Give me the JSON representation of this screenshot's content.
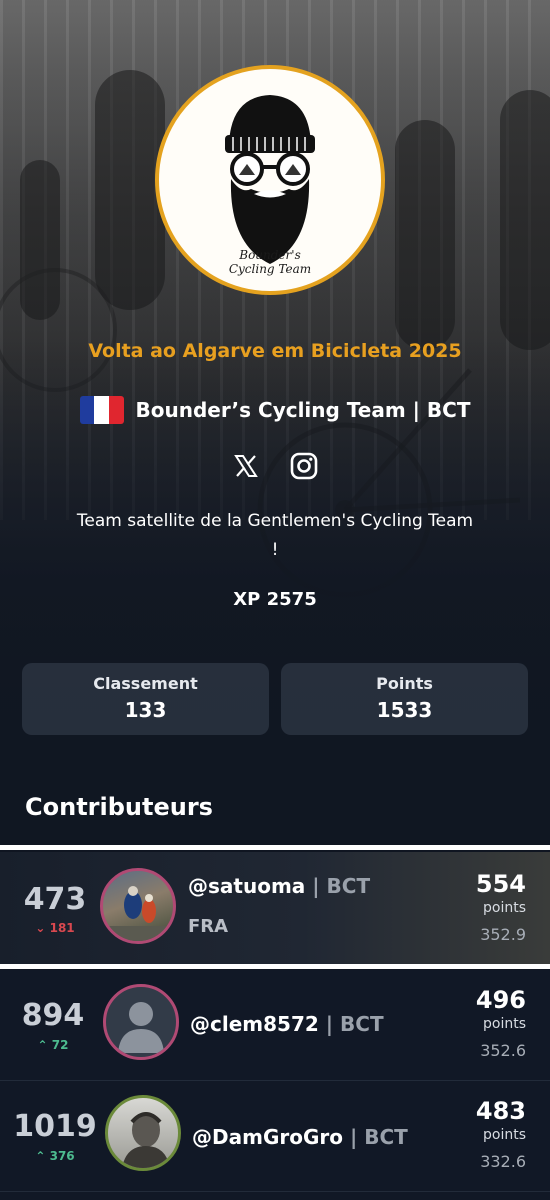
{
  "colors": {
    "accent": "#e8a020",
    "background": "#0f1521",
    "card": "#2c3442",
    "up": "#4dbb8f",
    "down": "#d9484f"
  },
  "team": {
    "logo_text_line1": "Bounder's",
    "logo_text_line2": "Cycling Team",
    "race_title": "Volta ao Algarve em Bicicleta 2025",
    "flag_icon": "france-flag-icon",
    "name": "Bounder’s Cycling Team | BCT",
    "social": [
      "x-icon",
      "instagram-icon"
    ],
    "description": "Team satellite de la Gentlemen's Cycling Team !",
    "xp": "XP 2575"
  },
  "stats": [
    {
      "label": "Classement",
      "value": "133"
    },
    {
      "label": "Points",
      "value": "1533"
    }
  ],
  "contributors": {
    "title": "Contributeurs",
    "items": [
      {
        "rank": "473",
        "delta": "181",
        "direction": "down",
        "user": "@satuoma",
        "team": "| BCT",
        "country": "FRA",
        "points": "554",
        "points_label": "points",
        "secondary": "352.9"
      },
      {
        "rank": "894",
        "delta": "72",
        "direction": "up",
        "user": "@clem8572",
        "team": "| BCT",
        "country": "",
        "points": "496",
        "points_label": "points",
        "secondary": "352.6"
      },
      {
        "rank": "1019",
        "delta": "376",
        "direction": "up",
        "user": "@DamGroGro",
        "team": "| BCT",
        "country": "",
        "points": "483",
        "points_label": "points",
        "secondary": "332.6"
      }
    ]
  }
}
